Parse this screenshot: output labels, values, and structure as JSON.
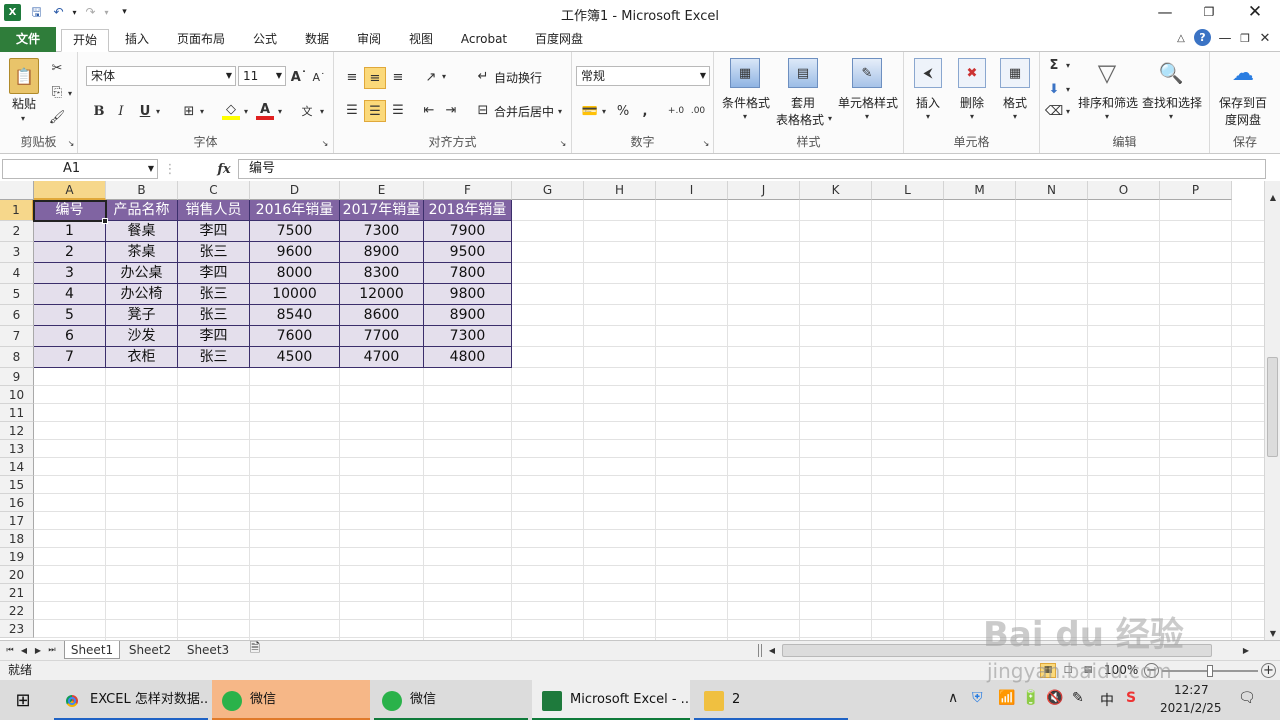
{
  "window": {
    "title": "工作簿1 - Microsoft Excel"
  },
  "quick_access": {
    "save": "save-icon",
    "undo": "undo-icon",
    "redo": "redo-icon"
  },
  "tabs": [
    "文件",
    "开始",
    "插入",
    "页面布局",
    "公式",
    "数据",
    "审阅",
    "视图",
    "Acrobat",
    "百度网盘"
  ],
  "ribbon": {
    "clipboard": {
      "paste": "粘贴",
      "label": "剪贴板"
    },
    "font": {
      "name": "宋体",
      "size": "11",
      "label": "字体"
    },
    "alignment": {
      "wrap": "自动换行",
      "merge": "合并后居中",
      "label": "对齐方式"
    },
    "number": {
      "format": "常规",
      "label": "数字"
    },
    "styles": {
      "cond": "条件格式",
      "table1": "套用",
      "table2": "表格格式",
      "cell": "单元格样式",
      "label": "样式"
    },
    "cells": {
      "insert": "插入",
      "delete": "删除",
      "format": "格式",
      "label": "单元格"
    },
    "editing": {
      "sort": "排序和筛选",
      "find": "查找和选择",
      "label": "编辑"
    },
    "save": {
      "line1": "保存到百",
      "line2": "度网盘",
      "label": "保存"
    }
  },
  "formula_bar": {
    "name_box": "A1",
    "fx": "fx",
    "value": "编号"
  },
  "columns": [
    "A",
    "B",
    "C",
    "D",
    "E",
    "F",
    "G",
    "H",
    "I",
    "J",
    "K",
    "L",
    "M",
    "N",
    "O",
    "P"
  ],
  "rows": [
    "1",
    "2",
    "3",
    "4",
    "5",
    "6",
    "7",
    "8",
    "9",
    "10",
    "11",
    "12",
    "13",
    "14",
    "15",
    "16",
    "17",
    "18",
    "19",
    "20",
    "21",
    "22",
    "23"
  ],
  "table": {
    "headers": [
      "编号",
      "产品名称",
      "销售人员",
      "2016年销量",
      "2017年销量",
      "2018年销量"
    ],
    "rows": [
      [
        "1",
        "餐桌",
        "李四",
        "7500",
        "7300",
        "7900"
      ],
      [
        "2",
        "茶桌",
        "张三",
        "9600",
        "8900",
        "9500"
      ],
      [
        "3",
        "办公桌",
        "李四",
        "8000",
        "8300",
        "7800"
      ],
      [
        "4",
        "办公椅",
        "张三",
        "10000",
        "12000",
        "9800"
      ],
      [
        "5",
        "凳子",
        "张三",
        "8540",
        "8600",
        "8900"
      ],
      [
        "6",
        "沙发",
        "李四",
        "7600",
        "7700",
        "7300"
      ],
      [
        "7",
        "衣柜",
        "张三",
        "4500",
        "4700",
        "4800"
      ]
    ]
  },
  "sheets": [
    "Sheet1",
    "Sheet2",
    "Sheet3"
  ],
  "status": {
    "ready": "就绪",
    "zoom": "100%"
  },
  "taskbar": {
    "items": [
      "EXCEL 怎样对数据...",
      "微信",
      "微信",
      "Microsoft Excel - ...",
      "2"
    ],
    "time": "12:27",
    "date": "2021/2/25",
    "ime": "中"
  },
  "watermark": {
    "brand": "Bai du 经验",
    "url": "jingyan.baidu.com"
  }
}
